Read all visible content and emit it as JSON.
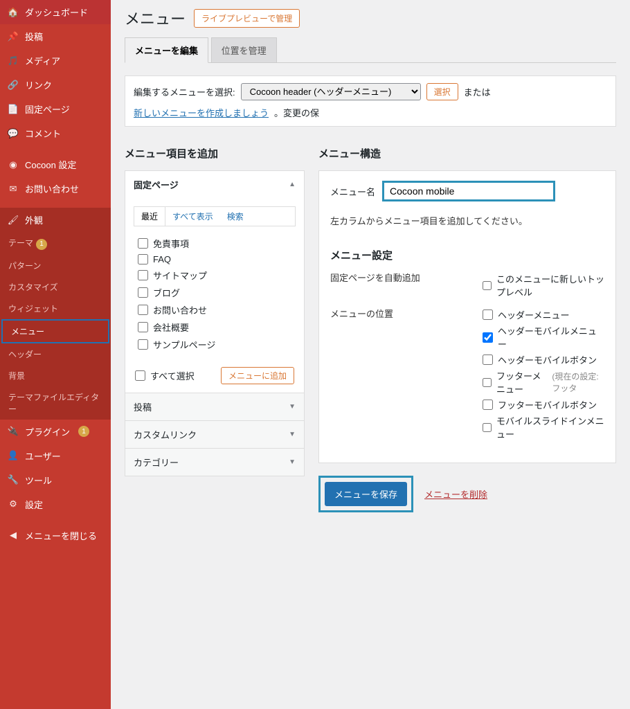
{
  "sidebar": {
    "items": [
      {
        "label": "ダッシュボード",
        "name": "dashboard"
      },
      {
        "label": "投稿",
        "name": "posts"
      },
      {
        "label": "メディア",
        "name": "media"
      },
      {
        "label": "リンク",
        "name": "links"
      },
      {
        "label": "固定ページ",
        "name": "pages"
      },
      {
        "label": "コメント",
        "name": "comments"
      },
      {
        "label": "Cocoon 設定",
        "name": "cocoon"
      },
      {
        "label": "お問い合わせ",
        "name": "contact"
      },
      {
        "label": "外観",
        "name": "appearance"
      },
      {
        "label": "プラグイン",
        "name": "plugins"
      },
      {
        "label": "ユーザー",
        "name": "users"
      },
      {
        "label": "ツール",
        "name": "tools"
      },
      {
        "label": "設定",
        "name": "settings"
      },
      {
        "label": "メニューを閉じる",
        "name": "collapse"
      }
    ],
    "appearance_sub": [
      {
        "label": "テーマ",
        "badge": "1"
      },
      {
        "label": "パターン"
      },
      {
        "label": "カスタマイズ"
      },
      {
        "label": "ウィジェット"
      },
      {
        "label": "メニュー"
      },
      {
        "label": "ヘッダー"
      },
      {
        "label": "背景"
      },
      {
        "label": "テーマファイルエディター"
      }
    ],
    "plugins_badge": "1"
  },
  "header": {
    "title": "メニュー",
    "preview_btn": "ライブプレビューで管理"
  },
  "tabs": [
    {
      "label": "メニューを編集"
    },
    {
      "label": "位置を管理"
    }
  ],
  "select_row": {
    "label": "編集するメニューを選択:",
    "selected": "Cocoon header (ヘッダーメニュー)",
    "select_btn": "選択",
    "or_text": "または",
    "create_link": "新しいメニューを作成しましょう",
    "tail": "。変更の保"
  },
  "left": {
    "title": "メニュー項目を追加",
    "sections": [
      {
        "label": "固定ページ"
      },
      {
        "label": "投稿"
      },
      {
        "label": "カスタムリンク"
      },
      {
        "label": "カテゴリー"
      }
    ],
    "page_tabs": [
      {
        "label": "最近"
      },
      {
        "label": "すべて表示"
      },
      {
        "label": "検索"
      }
    ],
    "pages": [
      "免責事項",
      "FAQ",
      "サイトマップ",
      "ブログ",
      "お問い合わせ",
      "会社概要",
      "サンプルページ"
    ],
    "select_all": "すべて選択",
    "add_btn": "メニューに追加"
  },
  "right": {
    "title": "メニュー構造",
    "name_label": "メニュー名",
    "name_value": "Cocoon mobile",
    "hint": "左カラムからメニュー項目を追加してください。",
    "settings_title": "メニュー設定",
    "auto_add_label": "固定ページを自動追加",
    "auto_add_opt": "このメニューに新しいトップレベル",
    "location_label": "メニューの位置",
    "locations": [
      {
        "label": "ヘッダーメニュー",
        "checked": false
      },
      {
        "label": "ヘッダーモバイルメニュー",
        "checked": true
      },
      {
        "label": "ヘッダーモバイルボタン",
        "checked": false
      },
      {
        "label": "フッターメニュー",
        "checked": false,
        "note": "(現在の設定: フッタ"
      },
      {
        "label": "フッターモバイルボタン",
        "checked": false
      },
      {
        "label": "モバイルスライドインメニュー",
        "checked": false
      }
    ],
    "save_btn": "メニューを保存",
    "delete_link": "メニューを削除"
  }
}
